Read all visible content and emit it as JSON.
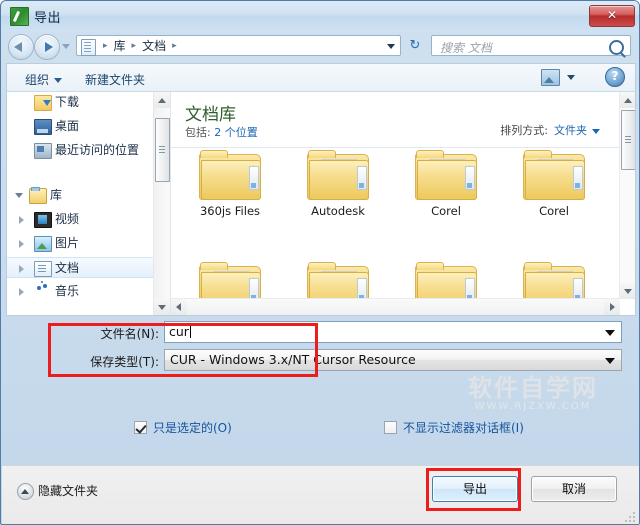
{
  "window": {
    "title": "导出",
    "app_icon": "green-brush-icon",
    "close_label": "✕"
  },
  "nav": {
    "back_icon": "back-arrow-icon",
    "forward_icon": "forward-arrow-icon",
    "history_dropdown_icon": "chevron-down-icon",
    "breadcrumb_icon": "document-icon",
    "breadcrumbs": [
      "库",
      "文档"
    ],
    "separator": "▸",
    "address_dropdown_icon": "chevron-down-icon",
    "refresh_icon": "refresh-icon",
    "refresh_glyph": "↻"
  },
  "search": {
    "placeholder": "搜索 文档",
    "icon": "search-icon"
  },
  "toolbar": {
    "organize": "组织",
    "new_folder": "新建文件夹",
    "view_icon": "view-mode-icon",
    "view_caret_icon": "chevron-down-icon",
    "help_icon": "help-icon",
    "help_glyph": "?"
  },
  "sidebar": {
    "items": [
      {
        "label": "下载",
        "icon": "download-folder-icon",
        "level": 1,
        "twisty": "none",
        "selected": false
      },
      {
        "label": "桌面",
        "icon": "desktop-icon",
        "level": 1,
        "twisty": "none",
        "selected": false
      },
      {
        "label": "最近访问的位置",
        "icon": "recent-places-icon",
        "level": 1,
        "twisty": "none",
        "selected": false
      },
      {
        "label": "库",
        "icon": "library-icon",
        "level": 0,
        "twisty": "open",
        "selected": false
      },
      {
        "label": "视频",
        "icon": "video-icon",
        "level": 1,
        "twisty": "closed",
        "selected": false
      },
      {
        "label": "图片",
        "icon": "pictures-icon",
        "level": 1,
        "twisty": "closed",
        "selected": false
      },
      {
        "label": "文档",
        "icon": "documents-icon",
        "level": 1,
        "twisty": "closed",
        "selected": true
      },
      {
        "label": "音乐",
        "icon": "music-icon",
        "level": 1,
        "twisty": "closed",
        "selected": false
      }
    ],
    "scrollbar": {
      "up_icon": "scroll-up-icon",
      "down_icon": "scroll-down-icon"
    }
  },
  "content": {
    "library_title": "文档库",
    "includes_label": "包括:",
    "includes_value": "2 个位置",
    "arrange_label": "排列方式:",
    "arrange_value": "文件夹",
    "arrange_caret_icon": "chevron-down-icon",
    "folders": [
      {
        "name": "360js Files",
        "style": "plain"
      },
      {
        "name": "Autodesk",
        "style": "doc"
      },
      {
        "name": "Corel",
        "style": "doc"
      },
      {
        "name": "Corel",
        "style": "doc"
      }
    ],
    "folders_row2": [
      {
        "name": "",
        "style": "dark"
      },
      {
        "name": "",
        "style": "doc"
      },
      {
        "name": "",
        "style": "plain"
      },
      {
        "name": "",
        "style": "orange"
      }
    ],
    "hscroll": {
      "left_icon": "scroll-left-icon",
      "right_icon": "scroll-right-icon"
    }
  },
  "form": {
    "filename_label": "文件名(N):",
    "filename_value": "cur",
    "filetype_label": "保存类型(T):",
    "filetype_value": "CUR - Windows 3.x/NT Cursor Resource",
    "dropdown_icon": "chevron-down-icon"
  },
  "options": {
    "only_selected": {
      "label": "只是选定的(O)",
      "checked": true
    },
    "no_filter_dialog": {
      "label": "不显示过滤器对话框(I)",
      "checked": false
    }
  },
  "footer": {
    "hide_folders": "隐藏文件夹",
    "hide_folders_icon": "collapse-up-icon",
    "export_button": "导出",
    "cancel_button": "取消"
  },
  "watermark": {
    "line1": "软件自学网",
    "line2": "WWW.RJZXW.COM"
  },
  "colors": {
    "accent": "#1a66b5",
    "title_text": "#0d2a49",
    "library_title": "#2f5d2f",
    "annotation_red": "#ee1d1d",
    "checkbox_label": "#15539e"
  }
}
